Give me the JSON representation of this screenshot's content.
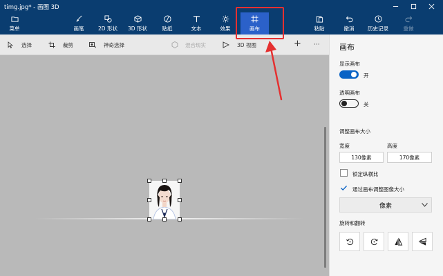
{
  "window": {
    "title": "timg.jpg* - 画图 3D",
    "controls": [
      "minimize-icon",
      "maximize-icon",
      "close-icon"
    ]
  },
  "ribbon": {
    "menu": "菜单",
    "brushes": "画笔",
    "shapes_2d": "2D 形状",
    "shapes_3d": "3D 形状",
    "stickers": "贴纸",
    "text": "文本",
    "effects": "效果",
    "canvas": "画布",
    "paste": "粘贴",
    "undo": "撤消",
    "history": "历史记录",
    "redo": "重做"
  },
  "toolbar": {
    "select": "选择",
    "crop": "裁剪",
    "magic_select": "神奇选择",
    "mixed_reality": "混合现实",
    "view_3d": "3D 视图",
    "add": "+",
    "more": "···"
  },
  "panel": {
    "title": "画布",
    "show_canvas_label": "显示画布",
    "show_canvas_state": "开",
    "show_canvas_on": true,
    "transparent_label": "透明画布",
    "transparent_state": "关",
    "transparent_on": false,
    "resize_header": "调整画布大小",
    "width_label": "宽度",
    "height_label": "高度",
    "width_value": "130像素",
    "height_value": "170像素",
    "lock_aspect_label": "锁定纵横比",
    "lock_aspect_checked": false,
    "resize_image_label": "通过画布调整图像大小",
    "resize_image_checked": true,
    "unit_value": "像素",
    "rotate_header": "旋转和翻转"
  },
  "colors": {
    "ribbon_bg": "#0a3d70",
    "active_tab": "#2b61c9",
    "toggle_on": "#0a63c5",
    "annotation": "#e53030",
    "canvas_bg": "#b9b9b9"
  }
}
